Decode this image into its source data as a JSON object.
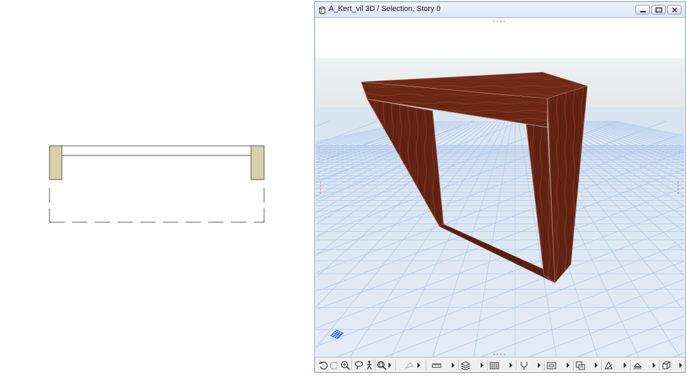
{
  "window": {
    "title": "A_Kert_vil 3D / Selection, Story 0"
  },
  "icons": {
    "title": "3d-window-icon",
    "minimize": "minimize-icon",
    "maximize": "maximize-icon",
    "close": "close-icon"
  },
  "toolbar": {
    "buttons": [
      "orbit-icon",
      "redo-view-icon",
      "zoom-icon",
      "lasso-icon",
      "walk-icon",
      "fit-zoom-icon",
      "explore-icon",
      "measure-icon",
      "layers-icon",
      "hatch-icon",
      "pen-icon",
      "display-icon",
      "partial-structure-icon",
      "perspective-icon",
      "shadow-icon",
      "view-window-icon"
    ]
  },
  "colors": {
    "wood": "#6e2a16",
    "grid": "#a8c4ee",
    "plan_fill": "#d8d0a8",
    "titlebar": "#dbe6f4"
  }
}
